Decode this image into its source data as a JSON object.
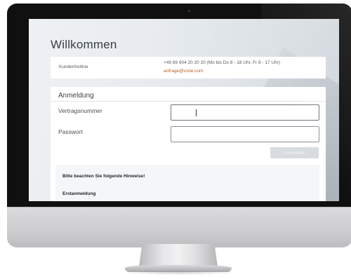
{
  "page": {
    "title": "Willkommen"
  },
  "hotline": {
    "label": "Kundenhotline",
    "phone": "+49 89 904 20 20 20 (Mo bis Do 8 - 18 Uhr, Fr 8 - 17 Uhr)",
    "email": "anfrage@vzde.com",
    "email_color": "#b5622e"
  },
  "login": {
    "title": "Anmeldung",
    "contract_label": "Vertragsnummer",
    "contract_value": "",
    "password_label": "Passwort",
    "password_value": "",
    "submit_label": "Anmelden",
    "submit_state": "disabled"
  },
  "notes": {
    "heading": "Bitte beachten Sie folgende Hinweise!",
    "first_login_heading": "Erstanmeldung"
  },
  "colors": {
    "bezel": "#101010",
    "screen_background": "#e7ebef",
    "text": "#3a3f46",
    "button_disabled": "#d8dbdf"
  }
}
